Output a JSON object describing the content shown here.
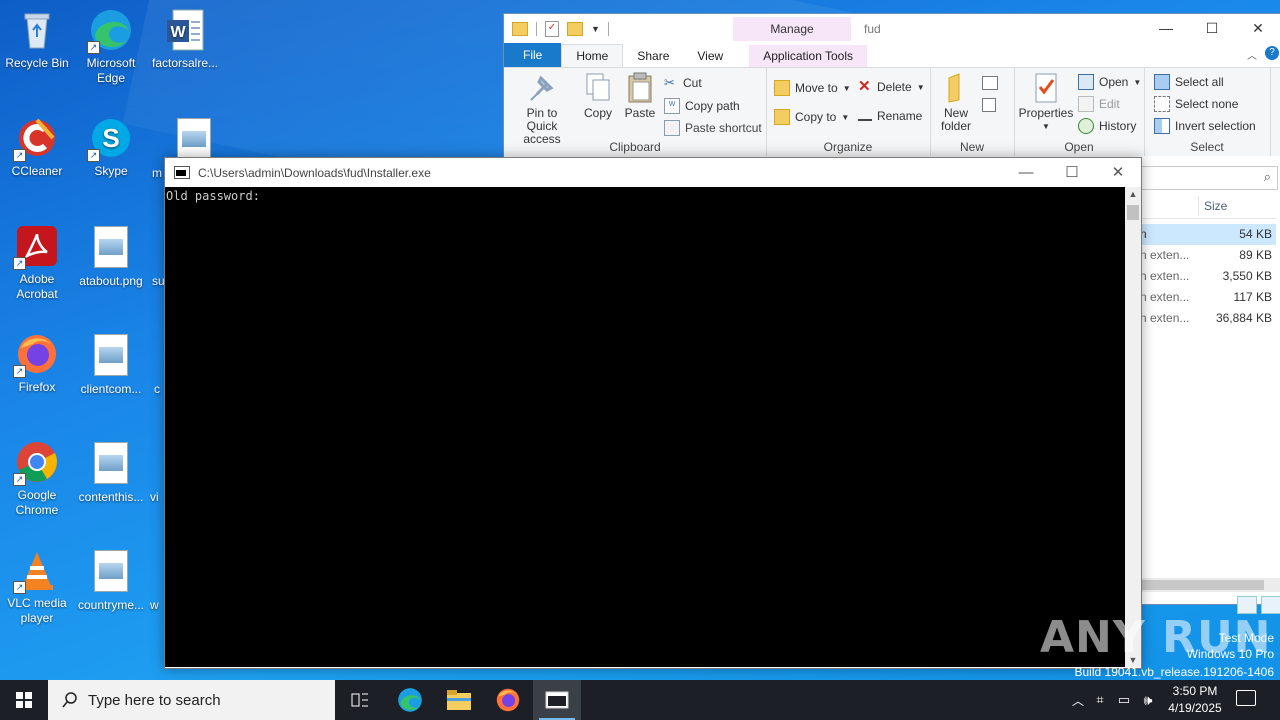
{
  "desktop": {
    "icons": [
      {
        "label": "Recycle Bin"
      },
      {
        "label": "Microsoft Edge"
      },
      {
        "label": "factorsalre..."
      },
      {
        "label": "CCleaner"
      },
      {
        "label": "Skype"
      },
      {
        "label": "m"
      },
      {
        "label": "Adobe Acrobat"
      },
      {
        "label": "atabout.png"
      },
      {
        "label": "su"
      },
      {
        "label": "Firefox"
      },
      {
        "label": "clientcom..."
      },
      {
        "label": "c"
      },
      {
        "label": "Google Chrome"
      },
      {
        "label": "contenthis..."
      },
      {
        "label": "vi"
      },
      {
        "label": "VLC media player"
      },
      {
        "label": "countryme..."
      },
      {
        "label": "w"
      }
    ]
  },
  "explorer": {
    "title": "fud",
    "contextual_tab": "Manage",
    "tabs": {
      "file": "File",
      "home": "Home",
      "share": "Share",
      "view": "View",
      "apptools": "Application Tools"
    },
    "clipboard": {
      "pin": "Pin to Quick access",
      "copy": "Copy",
      "paste": "Paste",
      "cut": "Cut",
      "copy_path": "Copy path",
      "paste_shortcut": "Paste shortcut",
      "group": "Clipboard"
    },
    "organize": {
      "move_to": "Move to",
      "copy_to": "Copy to",
      "delete": "Delete",
      "rename": "Rename",
      "group": "Organize"
    },
    "new": {
      "new_folder": "New folder",
      "group": "New"
    },
    "open": {
      "properties": "Properties",
      "open": "Open",
      "edit": "Edit",
      "history": "History",
      "group": "Open"
    },
    "select": {
      "select_all": "Select all",
      "select_none": "Select none",
      "invert": "Invert selection",
      "group": "Select"
    },
    "column_size": "Size",
    "rows": [
      {
        "type": "n",
        "size": "54 KB"
      },
      {
        "type": "n exten...",
        "size": "89 KB"
      },
      {
        "type": "n exten...",
        "size": "3,550 KB"
      },
      {
        "type": "n exten...",
        "size": "117 KB"
      },
      {
        "type": "n exten...",
        "size": "36,884 KB"
      }
    ]
  },
  "console": {
    "title": "C:\\Users\\admin\\Downloads\\fud\\Installer.exe",
    "output": "Old password:"
  },
  "watermark": {
    "logo": "ANY RUN",
    "mode": "Test Mode",
    "edition": "Windows 10 Pro",
    "build": "Build 19041.vb_release.191206-1406"
  },
  "taskbar": {
    "search_placeholder": "Type here to search",
    "time": "3:50 PM",
    "date": "4/19/2025"
  },
  "colors": {
    "accent": "#1979ca",
    "desktop": "#1a86e8",
    "taskbar": "#1c2026"
  }
}
